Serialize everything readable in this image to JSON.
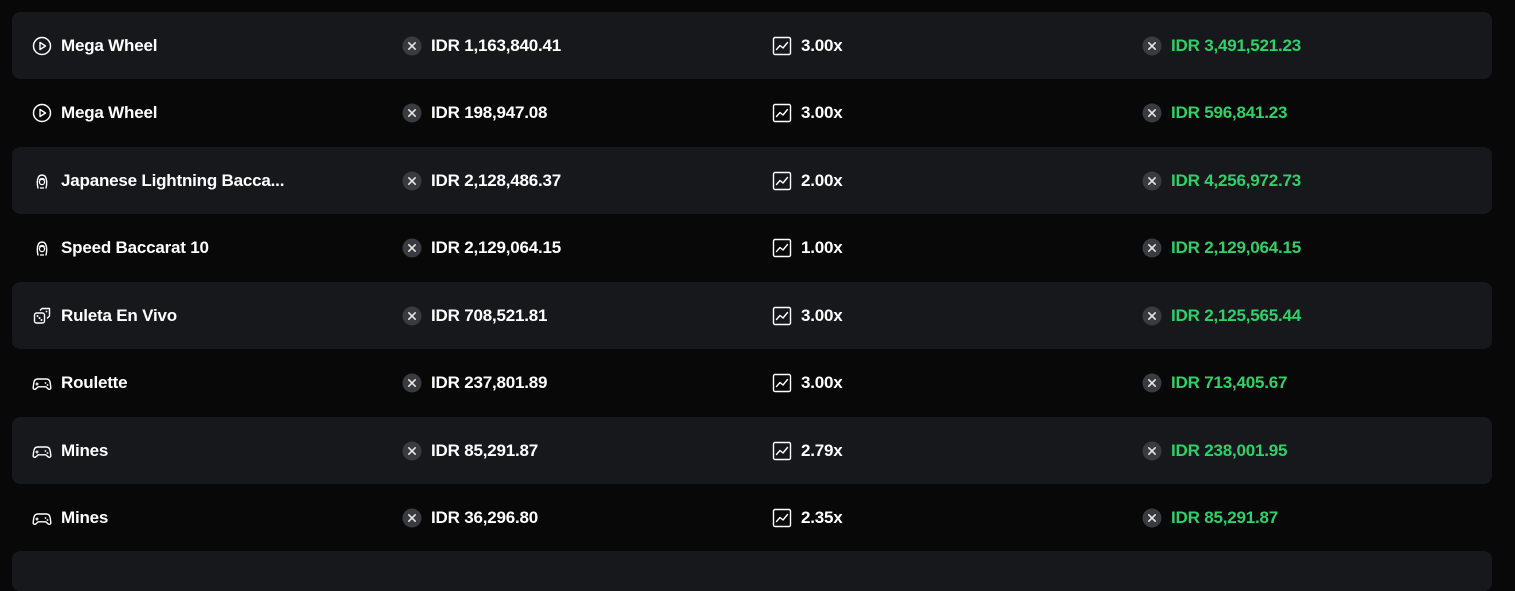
{
  "rows": [
    {
      "game": "Mega Wheel",
      "game_icon": "play-circle-icon",
      "bet": "IDR 1,163,840.41",
      "multiplier": "3.00x",
      "payout": "IDR 3,491,521.23",
      "shaded": true
    },
    {
      "game": "Mega Wheel",
      "game_icon": "play-circle-icon",
      "bet": "IDR 198,947.08",
      "multiplier": "3.00x",
      "payout": "IDR 596,841.23",
      "shaded": false
    },
    {
      "game": "Japanese Lightning Bacca...",
      "game_icon": "dealer-icon",
      "bet": "IDR 2,128,486.37",
      "multiplier": "2.00x",
      "payout": "IDR 4,256,972.73",
      "shaded": true
    },
    {
      "game": "Speed Baccarat 10",
      "game_icon": "dealer-icon",
      "bet": "IDR 2,129,064.15",
      "multiplier": "1.00x",
      "payout": "IDR 2,129,064.15",
      "shaded": false
    },
    {
      "game": "Ruleta En Vivo",
      "game_icon": "dice-icon",
      "bet": "IDR 708,521.81",
      "multiplier": "3.00x",
      "payout": "IDR 2,125,565.44",
      "shaded": true
    },
    {
      "game": "Roulette",
      "game_icon": "gamepad-icon",
      "bet": "IDR 237,801.89",
      "multiplier": "3.00x",
      "payout": "IDR 713,405.67",
      "shaded": false
    },
    {
      "game": "Mines",
      "game_icon": "gamepad-icon",
      "bet": "IDR 85,291.87",
      "multiplier": "2.79x",
      "payout": "IDR 238,001.95",
      "shaded": true
    },
    {
      "game": "Mines",
      "game_icon": "gamepad-icon",
      "bet": "IDR 36,296.80",
      "multiplier": "2.35x",
      "payout": "IDR 85,291.87",
      "shaded": false
    }
  ],
  "icons": {
    "currency": "currency-x-icon",
    "multiplier": "trend-chart-icon"
  },
  "colors": {
    "background": "#080809",
    "row_shaded": "#17181c",
    "payout_green": "#2fd06a",
    "currency_icon_bg": "#3a3b40"
  }
}
